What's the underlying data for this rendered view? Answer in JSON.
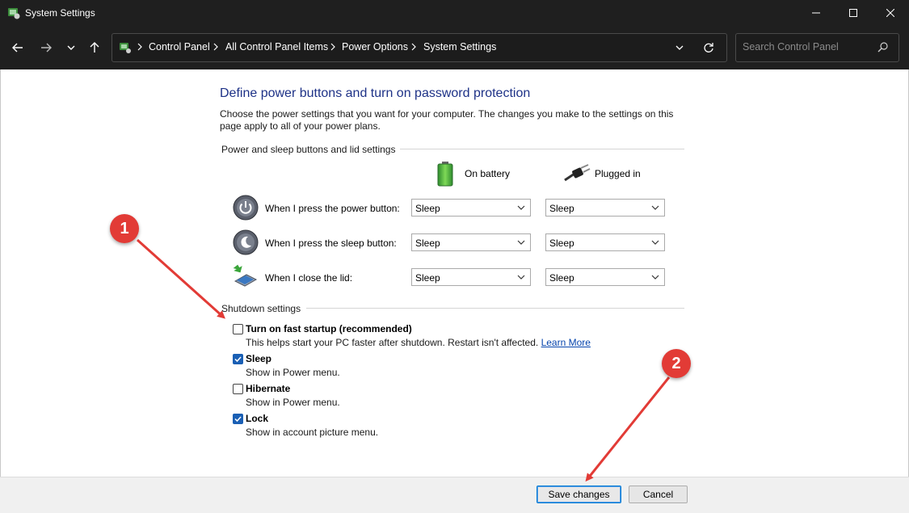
{
  "window": {
    "title": "System Settings"
  },
  "nav": {
    "breadcrumb": [
      "Control Panel",
      "All Control Panel Items",
      "Power Options",
      "System Settings"
    ],
    "search_placeholder": "Search Control Panel"
  },
  "page": {
    "heading": "Define power buttons and turn on password protection",
    "description": "Choose the power settings that you want for your computer. The changes you make to the settings on this page apply to all of your power plans.",
    "power_group_label": "Power and sleep buttons and lid settings",
    "col_battery": "On battery",
    "col_plugged": "Plugged in",
    "rows": [
      {
        "label": "When I press the power button:",
        "battery": "Sleep",
        "plugged": "Sleep"
      },
      {
        "label": "When I press the sleep button:",
        "battery": "Sleep",
        "plugged": "Sleep"
      },
      {
        "label": "When I close the lid:",
        "battery": "Sleep",
        "plugged": "Sleep"
      }
    ],
    "shutdown_group_label": "Shutdown settings",
    "shutdown": [
      {
        "label": "Turn on fast startup (recommended)",
        "sub": "This helps start your PC faster after shutdown. Restart isn't affected.",
        "link": "Learn More",
        "checked": false
      },
      {
        "label": "Sleep",
        "sub": "Show in Power menu.",
        "checked": true
      },
      {
        "label": "Hibernate",
        "sub": "Show in Power menu.",
        "checked": false
      },
      {
        "label": "Lock",
        "sub": "Show in account picture menu.",
        "checked": true
      }
    ]
  },
  "footer": {
    "save_label": "Save changes",
    "cancel_label": "Cancel"
  },
  "annotations": {
    "badge1": "1",
    "badge2": "2"
  },
  "colors": {
    "heading": "#1e3287",
    "checkbox_checked": "#1a5fb4",
    "badge": "#e23b36",
    "titlebar": "#1f1f1f"
  }
}
